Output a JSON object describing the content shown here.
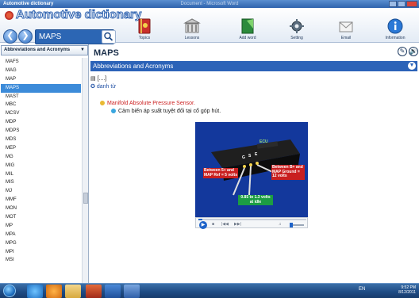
{
  "window": {
    "app_title": "Automotive dictionary",
    "document_title": "Document - Microsoft Word"
  },
  "header": {
    "logo_text": "Automotive dictionary",
    "search_value": "MAPS",
    "tools": [
      {
        "label": "Topics",
        "icon": "topics-book-icon"
      },
      {
        "label": "Lessons",
        "icon": "lessons-building-icon"
      },
      {
        "label": "Add word",
        "icon": "add-word-notebook-icon"
      },
      {
        "label": "Setting",
        "icon": "setting-gear-icon"
      },
      {
        "label": "Email",
        "icon": "email-envelope-icon"
      },
      {
        "label": "Information",
        "icon": "information-icon"
      }
    ]
  },
  "sidebar": {
    "category": "Abbreviations and Acronyms",
    "items": [
      "MAFS",
      "MAG",
      "MAP",
      "MAPS",
      "MAST",
      "MBC",
      "MCSV",
      "MDP",
      "MDPS",
      "MDS",
      "MEP",
      "MG",
      "MIG",
      "MIL",
      "MIS",
      "MJ",
      "MMF",
      "MON",
      "MOT",
      "MP",
      "MPA",
      "MPG",
      "MPI",
      "MSI"
    ],
    "selected": "MAPS"
  },
  "main": {
    "title": "MAPS",
    "section": "Abbreviations and Acronyms",
    "tag": "[....]",
    "pos": "danh từ",
    "definition": "Manifold Absolute Pressure Sensor.",
    "translation": "Cảm biến áp suất tuyệt đối tại cổ góp hút."
  },
  "video": {
    "display_text": "ECU",
    "pins": [
      "G",
      "S",
      "E"
    ],
    "label_left": "Between 5+ and MAP Ref = 5 volts",
    "label_right": "Between B+ and MAP Ground = 12 volts",
    "label_bottom": "0.85 to 1.3 volts at idle",
    "progress": 0.04
  },
  "taskbar": {
    "language": "EN",
    "time": "9:52 PM",
    "date": "8/12/2011"
  },
  "colors": {
    "accent": "#2c63b8",
    "selection": "#3c8bd9",
    "definition": "#cc2020",
    "video_bg": "#13389c"
  }
}
